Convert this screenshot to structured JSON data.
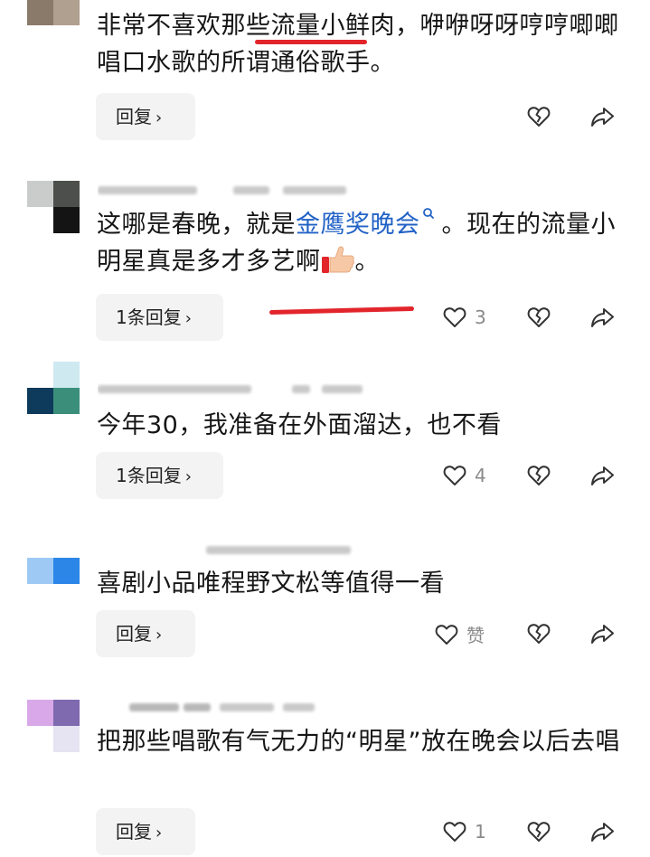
{
  "comments": [
    {
      "text_a": "非常不喜欢那些流量小鲜肉，咿咿呀呀哼哼唧唧唱口水歌的所谓通俗歌手。",
      "reply_label": "回复",
      "like_label": "",
      "avatar_colors": [
        "#8a7a6a",
        "#6b5a4a",
        "#b0a090",
        "#ffffff"
      ]
    },
    {
      "text_a": "这哪是春晚，就是",
      "link_text": "金鹰奖晚会",
      "text_b": "。现在的流量小明星真是多才多艺啊",
      "text_c": "。",
      "reply_label": "1条回复",
      "like_count": "3",
      "avatar_colors": [
        "#c9ccca",
        "#4d4f4c",
        "#ffffff",
        "#141414"
      ]
    },
    {
      "text_a": "今年30，我准备在外面溜达，也不看",
      "reply_label": "1条回复",
      "like_count": "4",
      "avatar_colors": [
        "#ffffff",
        "#cfe9f1",
        "#0e3a5c",
        "#3b8f7a"
      ]
    },
    {
      "text_a": "喜剧小品唯程野文松等值得一看",
      "reply_label": "回复",
      "like_label": "赞",
      "avatar_colors": [
        "#ffffff",
        "#ffffff",
        "#9ec9f5",
        "#2b86e8"
      ]
    },
    {
      "text_a": "把那些唱歌有气无力的“明星”放在晚会以后去唱",
      "reply_label": "回复",
      "like_count": "1",
      "avatar_colors": [
        "#d9a8e8",
        "#7f6ab0",
        "#ffffff",
        "#e6e3f2"
      ]
    }
  ],
  "colors": {
    "link": "#2162c6",
    "underline": "#e2252b",
    "icon": "#333333"
  }
}
